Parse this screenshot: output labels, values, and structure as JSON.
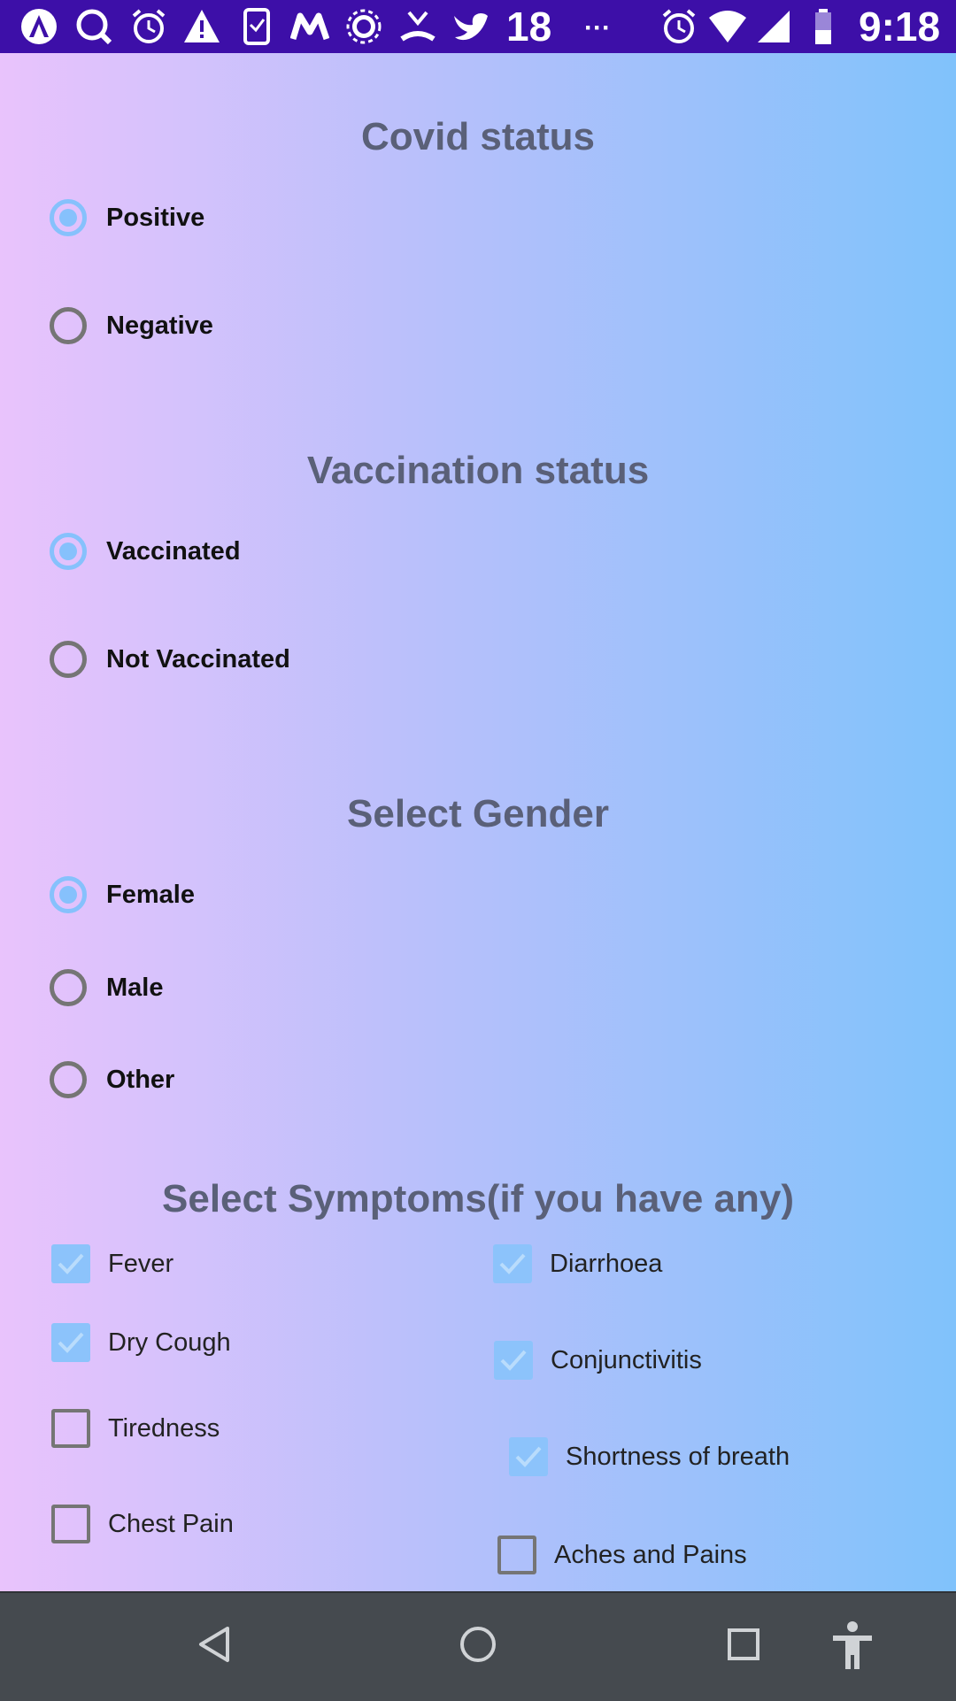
{
  "status_bar": {
    "notification_count": "18",
    "overflow": "···",
    "time": "9:18"
  },
  "covid": {
    "title": "Covid status",
    "options": [
      {
        "label": "Positive",
        "selected": true
      },
      {
        "label": "Negative",
        "selected": false
      }
    ]
  },
  "vaccination": {
    "title": "Vaccination status",
    "options": [
      {
        "label": "Vaccinated",
        "selected": true
      },
      {
        "label": "Not Vaccinated",
        "selected": false
      }
    ]
  },
  "gender": {
    "title": "Select Gender",
    "options": [
      {
        "label": "Female",
        "selected": true
      },
      {
        "label": "Male",
        "selected": false
      },
      {
        "label": "Other",
        "selected": false
      }
    ]
  },
  "symptoms": {
    "title": "Select Symptoms(if you have any)",
    "left": [
      {
        "label": "Fever",
        "checked": true
      },
      {
        "label": "Dry Cough",
        "checked": true
      },
      {
        "label": "Tiredness",
        "checked": false
      },
      {
        "label": "Chest Pain",
        "checked": false
      }
    ],
    "right": [
      {
        "label": "Diarrhoea",
        "checked": true
      },
      {
        "label": "Conjunctivitis",
        "checked": true
      },
      {
        "label": "Shortness of breath",
        "checked": true
      },
      {
        "label": "Aches and Pains",
        "checked": false
      }
    ]
  },
  "colors": {
    "status_bar": "#3d0fa8",
    "accent": "#86c1fc",
    "title_text": "#5a6078",
    "nav_bar": "#454a4f"
  }
}
